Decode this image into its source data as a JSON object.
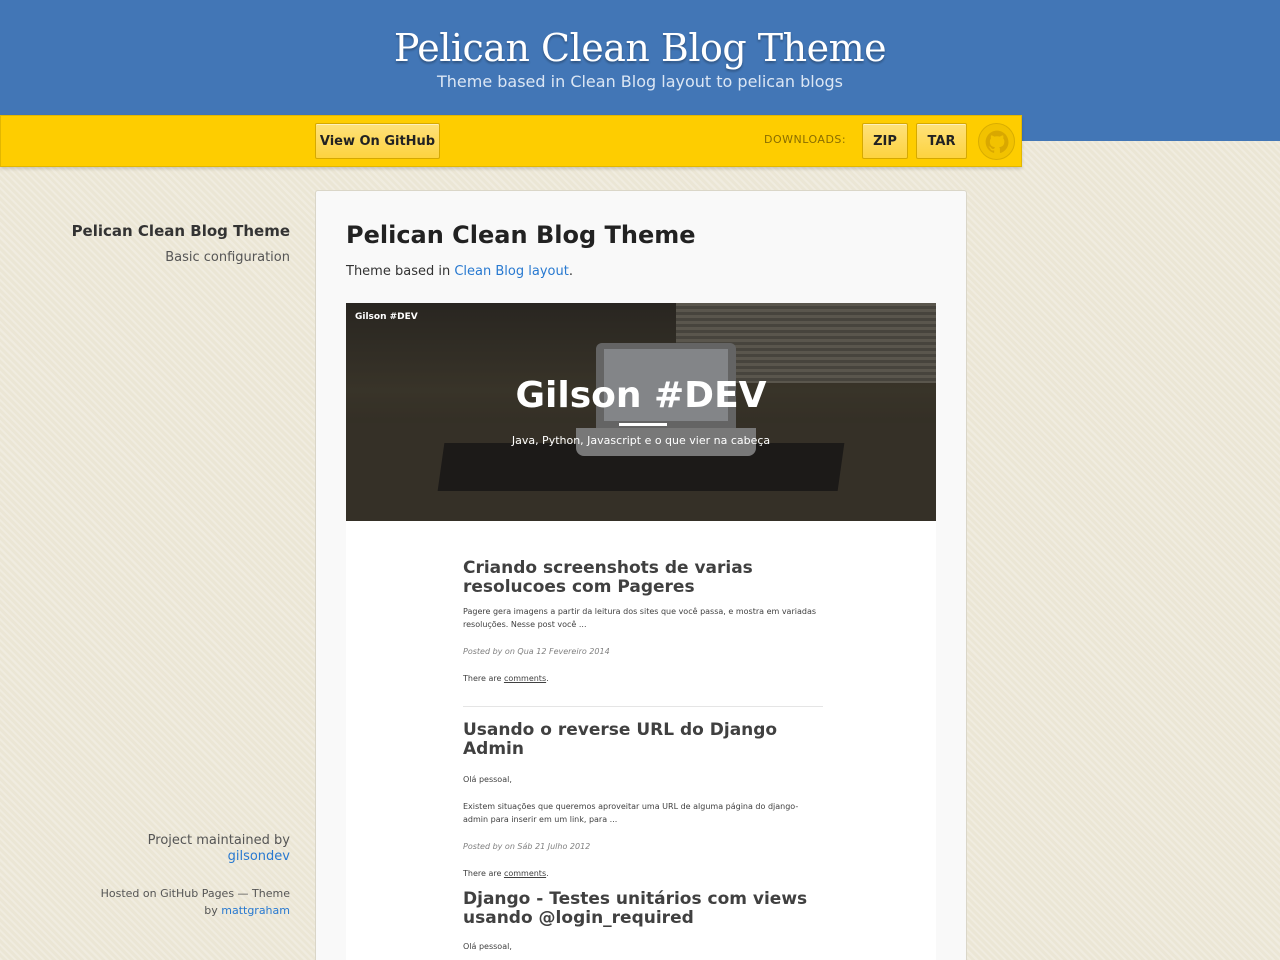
{
  "header": {
    "title": "Pelican Clean Blog Theme",
    "tagline": "Theme based in Clean Blog layout to pelican blogs"
  },
  "ribbon": {
    "github_label": "View On GitHub",
    "downloads_label": "DOWNLOADS:",
    "zip_label": "ZIP",
    "tar_label": "TAR"
  },
  "sidebar": {
    "title": "Pelican Clean Blog Theme",
    "items": [
      {
        "label": "Basic configuration"
      }
    ],
    "maintained_by": "Project maintained by",
    "maintainer": "gilsondev",
    "hosted": "Hosted on GitHub Pages — Theme",
    "by": "by",
    "theme_author": "mattgraham"
  },
  "main": {
    "title": "Pelican Clean Blog Theme",
    "intro_prefix": "Theme based in ",
    "intro_link": "Clean Blog layout",
    "intro_suffix": "."
  },
  "screenshot": {
    "brand": "Gilson #DEV",
    "hero_title": "Gilson #DEV",
    "hero_subtitle": "Java, Python, Javascript e o que vier na cabeça",
    "posts": [
      {
        "title": "Criando screenshots de varias resolucoes com Pageres",
        "excerpt": "Pagere gera imagens a partir da leitura dos sites que você passa, e mostra em variadas resoluções. Nesse post você ...",
        "meta": "Posted by on Qua 12 Fevereiro 2014",
        "comments_prefix": "There are ",
        "comments_link": "comments",
        "comments_suffix": "."
      },
      {
        "title": "Usando o reverse URL do Django Admin",
        "greeting": "Olá pessoal,",
        "excerpt": "Existem situações que queremos aproveitar uma URL de alguma página do django-admin para inserir em um link, para ...",
        "meta": "Posted by on Sáb 21 Julho 2012",
        "comments_prefix": "There are ",
        "comments_link": "comments",
        "comments_suffix": "."
      },
      {
        "title": "Django - Testes unitários com views usando @login_required",
        "greeting": "Olá pessoal,"
      }
    ]
  },
  "colors": {
    "header_blue": "#4276b6",
    "ribbon_yellow": "#fecd00",
    "link": "#2879d0",
    "background": "#ebe6d5"
  },
  "icons": {
    "github": "octocat-icon"
  }
}
